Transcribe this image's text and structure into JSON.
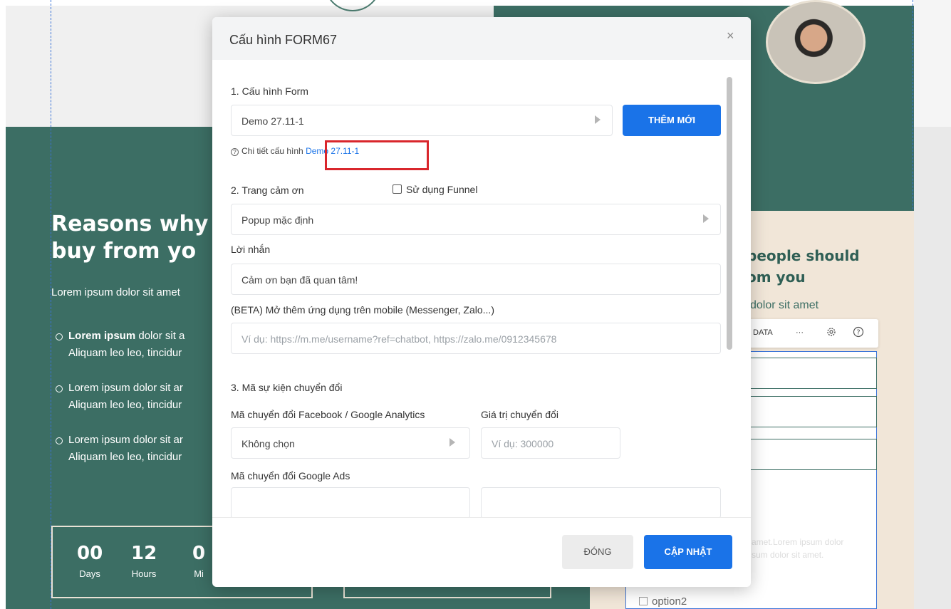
{
  "background": {
    "heading_line1": "Reasons why",
    "heading_line2": "buy from yo",
    "lorem": "Lorem ipsum dolor sit amet",
    "bullets": [
      {
        "bold": "Lorem ipsum",
        "line1": " dolor sit a",
        "line2": "Aliquam leo leo, tincidur"
      },
      {
        "bold": "",
        "line1": "Lorem ipsum dolor sit ar",
        "line2": "Aliquam leo leo, tincidur"
      },
      {
        "bold": "",
        "line1": "Lorem ipsum dolor sit ar",
        "line2": "Aliquam leo leo, tincidur"
      }
    ],
    "countdown": [
      {
        "num": "00",
        "label": "Days"
      },
      {
        "num": "12",
        "label": "Hours"
      },
      {
        "num": "0",
        "label": "Mi"
      }
    ],
    "right_title_line1": "people should",
    "right_title_line2": "om you",
    "right_lorem": "dolor sit amet",
    "toolbar": {
      "data_label": "DATA",
      "more_label": "···"
    },
    "textarea_line1": "amet.Lorem ipsum dolor",
    "textarea_line2": "sum dolor sit amet.",
    "option2": "option2"
  },
  "modal": {
    "title": "Cấu hình FORM67",
    "close_label": "×",
    "section1_label": "1. Cấu hình Form",
    "form_select_value": "Demo 27.11-1",
    "add_new_label": "THÊM MỚI",
    "detail_prefix": "Chi tiết cấu hình",
    "detail_link": "Demo 27.11-1",
    "section2_label": "2. Trang cảm ơn",
    "funnel_label": "Sử dụng Funnel",
    "thankyou_select_value": "Popup mặc định",
    "message_label": "Lời nhắn",
    "message_value": "Cảm ơn bạn đã quan tâm!",
    "beta_label": "(BETA) Mở thêm ứng dụng trên mobile (Messenger, Zalo...)",
    "beta_placeholder": "Ví dụ: https://m.me/username?ref=chatbot, https://zalo.me/0912345678",
    "section3_label": "3. Mã sự kiện chuyển đổi",
    "fb_ga_label": "Mã chuyển đổi Facebook / Google Analytics",
    "conv_value_label": "Giá trị chuyển đổi",
    "fb_ga_select_value": "Không chọn",
    "conv_value_placeholder": "Ví dụ: 300000",
    "google_ads_label": "Mã chuyển đổi Google Ads",
    "close_button_label": "ĐÓNG",
    "update_button_label": "CẬP NHẬT"
  },
  "colors": {
    "primary": "#1a73e8",
    "teal_background": "#3c6e64",
    "highlight_red": "#d9262c"
  }
}
